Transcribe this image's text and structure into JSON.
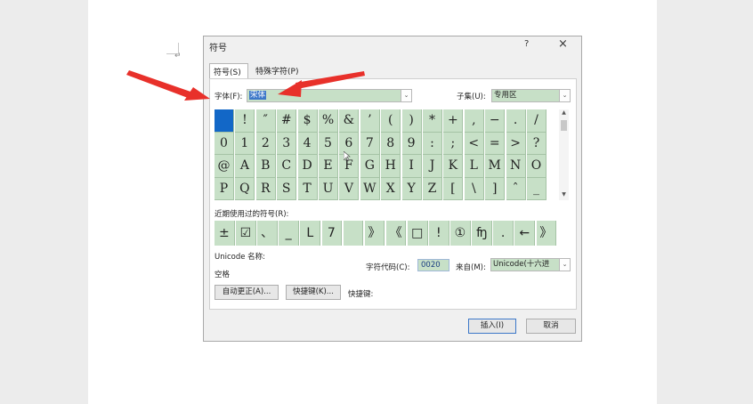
{
  "dialog": {
    "title": "符号",
    "help": "?",
    "close": "×"
  },
  "tabs": [
    {
      "label": "符号(S)",
      "active": true
    },
    {
      "label": "特殊字符(P)",
      "active": false
    }
  ],
  "font": {
    "label": "字体(F):",
    "value": "宋体"
  },
  "subset": {
    "label": "子集(U):",
    "value": "专用区"
  },
  "symbols": [
    [
      "",
      "!",
      "″",
      "#",
      "$",
      "%",
      "&",
      "’",
      "(",
      ")",
      "*",
      "+",
      ",",
      "−",
      ".",
      "/"
    ],
    [
      "0",
      "1",
      "2",
      "3",
      "4",
      "5",
      "6",
      "7",
      "8",
      "9",
      ":",
      ";",
      "<",
      "=",
      ">",
      "?"
    ],
    [
      "@",
      "A",
      "B",
      "C",
      "D",
      "E",
      "F",
      "G",
      "H",
      "I",
      "J",
      "K",
      "L",
      "M",
      "N",
      "O"
    ],
    [
      "P",
      "Q",
      "R",
      "S",
      "T",
      "U",
      "V",
      "W",
      "X",
      "Y",
      "Z",
      "[",
      "\\",
      "]",
      "ˆ",
      "_"
    ]
  ],
  "recent": {
    "label": "近期使用过的符号(R):",
    "symbols": [
      "±",
      "☑",
      "、",
      "_",
      "L",
      "7",
      "",
      "》",
      "《",
      "□",
      "!",
      "①",
      "ʩ",
      ".",
      "←",
      "》"
    ]
  },
  "unicode_name": {
    "label": "Unicode 名称:",
    "value": "空格"
  },
  "char_code": {
    "label": "字符代码(C):",
    "value": "0020"
  },
  "from": {
    "label": "来自(M):",
    "value": "Unicode(十六进"
  },
  "buttons": {
    "autocorrect": "自动更正(A)...",
    "shortcut_key": "快捷键(K)...",
    "shortcut_label": "快捷键:",
    "insert": "插入(I)",
    "cancel": "取消"
  },
  "colors": {
    "annotation_arrow": "#e8302a",
    "cell_green": "#c7e0c7",
    "selection_blue": "#1267c7"
  }
}
